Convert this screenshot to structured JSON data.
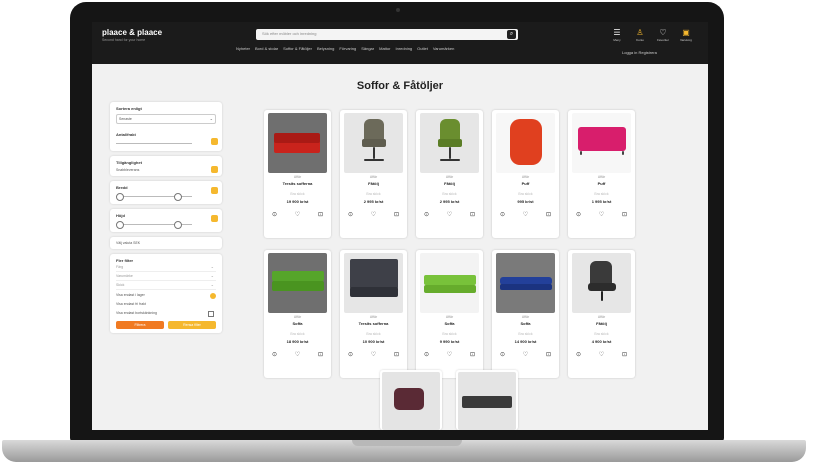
{
  "header": {
    "logo": "plaace & plaace",
    "logo_tagline": "Second hand for your home",
    "search_placeholder": "Sök efter möbler och inredning",
    "nav": [
      "Nyheter",
      "Bord & stolar",
      "Soffor & Fåtöljer",
      "Belysning",
      "Förvaring",
      "Sängar",
      "Mattor",
      "Inredning",
      "Outlet",
      "Varumärken"
    ],
    "icons": [
      {
        "label": "Meny",
        "icon": "menu-icon"
      },
      {
        "label": "Konto",
        "icon": "user-icon"
      },
      {
        "label": "Favoriter",
        "icon": "heart-icon"
      },
      {
        "label": "Varukorg",
        "icon": "cart-icon"
      }
    ],
    "login_text": "Logga in   Registrera"
  },
  "page_title": "Soffor & Fåtöljer",
  "sidebar": {
    "sort_label": "Sortera enligt",
    "sort_value": "Senaste",
    "price_label": "Antal/frakt",
    "free_shipping_label": "Tillgänglighet",
    "free_shipping_value": "Snabbleverans",
    "width_label": "Bredd",
    "height_label": "Höjd",
    "currency_label": "Välj valuta",
    "currency_value": "SEK",
    "filters_label": "Fler filter",
    "filter_rows": [
      "Färg",
      "Varumärke",
      "Skick"
    ],
    "check_rows": [
      "Visa endast i lager",
      "Visa endast fri frakt",
      "Visa endast bortskänkning"
    ],
    "apply_button": "Filtrera",
    "reset_button": "Rensa filter"
  },
  "products": [
    {
      "store": "Affär",
      "name": "Tresits sofferna",
      "quality": "Bra skick",
      "price": "19 900 kr/st"
    },
    {
      "store": "Affär",
      "name": "Fåtölj",
      "quality": "Bra skick",
      "price": "2 995 kr/st"
    },
    {
      "store": "Affär",
      "name": "Fåtölj",
      "quality": "Bra skick",
      "price": "2 995 kr/st"
    },
    {
      "store": "Affär",
      "name": "Puff",
      "quality": "Bra skick",
      "price": "995 kr/st"
    },
    {
      "store": "Affär",
      "name": "Puff",
      "quality": "Bra skick",
      "price": "1 995 kr/st"
    },
    {
      "store": "Affär",
      "name": "Soffa",
      "quality": "Bra skick",
      "price": "18 900 kr/st"
    },
    {
      "store": "Affär",
      "name": "Tresits sofferna",
      "quality": "Bra skick",
      "price": "10 900 kr/st"
    },
    {
      "store": "Affär",
      "name": "Soffa",
      "quality": "Bra skick",
      "price": "9 990 kr/st"
    },
    {
      "store": "Affär",
      "name": "Soffa",
      "quality": "Bra skick",
      "price": "14 900 kr/st"
    },
    {
      "store": "Affär",
      "name": "Fåtölj",
      "quality": "Bra skick",
      "price": "4 900 kr/st"
    }
  ],
  "colors": {
    "accent": "#f5b82e",
    "header_bg": "#1b1b1b",
    "orange": "#f07a22"
  }
}
